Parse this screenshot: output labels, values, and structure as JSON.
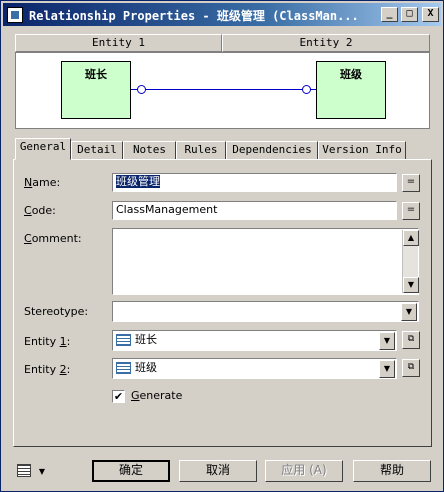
{
  "window": {
    "title": "Relationship Properties - 班级管理 (ClassMan...",
    "min_btn": "_",
    "max_btn": "□",
    "close_btn": "X"
  },
  "diagram": {
    "col1_header": "Entity 1",
    "col2_header": "Entity 2",
    "entity1_name": "班长",
    "entity2_name": "班级"
  },
  "tabs": [
    {
      "label": "General"
    },
    {
      "label": "Detail"
    },
    {
      "label": "Notes"
    },
    {
      "label": "Rules"
    },
    {
      "label": "Dependencies"
    },
    {
      "label": "Version Info"
    }
  ],
  "form": {
    "name_label_u": "N",
    "name_label_rest": "ame:",
    "name_value": "班级管理",
    "code_label_u": "C",
    "code_label_rest": "ode:",
    "code_value": "ClassManagement",
    "comment_label_u": "C",
    "comment_label_rest": "omment:",
    "comment_value": "",
    "stereotype_label": "Stereotype:",
    "stereotype_value": "",
    "entity1_label_pre": "Entity ",
    "entity1_label_u": "1",
    "entity1_label_post": ":",
    "entity1_value": "班长",
    "entity2_label_pre": "Entity ",
    "entity2_label_u": "2",
    "entity2_label_post": ":",
    "entity2_value": "班级",
    "generate_label_u": "G",
    "generate_label_rest": "enerate",
    "generate_checked": "✔",
    "ellipsis": "=",
    "prop_icon": "⧉"
  },
  "buttons": {
    "ok": "确定",
    "cancel": "取消",
    "apply": "应用 (A)",
    "help": "帮助",
    "menu_arrow": "▼"
  },
  "colors": {
    "title_start": "#0a246a",
    "entity_fill": "#ccffcc",
    "link": "#0000cc"
  }
}
